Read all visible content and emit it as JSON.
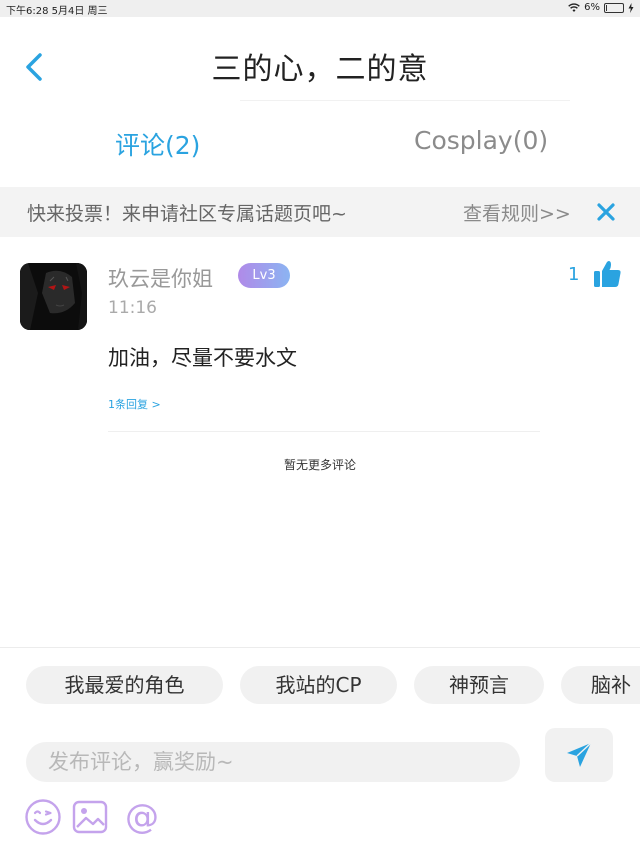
{
  "status_bar": {
    "time_date": "下午6:28   5月4日 周三",
    "battery": "6%",
    "battery_level": 0.06
  },
  "header": {
    "title": "三的心，二的意"
  },
  "tabs": [
    {
      "label": "评论(2)",
      "active": true
    },
    {
      "label": "Cosplay(0)",
      "active": false
    }
  ],
  "banner": {
    "text": "快来投票！来申请社区专属话题页吧~",
    "rules_link": "查看规则>>"
  },
  "comment": {
    "username": "玖云是你姐",
    "level": "Lv3",
    "time": "11:16",
    "likes": "1",
    "content": "加油，尽量不要水文",
    "replies": "1条回复 >"
  },
  "no_more": "暂无更多评论",
  "composer": {
    "chips": [
      "我最爱的角色",
      "我站的CP",
      "神预言",
      "脑补"
    ],
    "placeholder": "发布评论，赢奖励~"
  },
  "colors": {
    "accent": "#2aa3e0",
    "level_badge": "#a59be9",
    "icon_purple": "#c4a3ec"
  }
}
